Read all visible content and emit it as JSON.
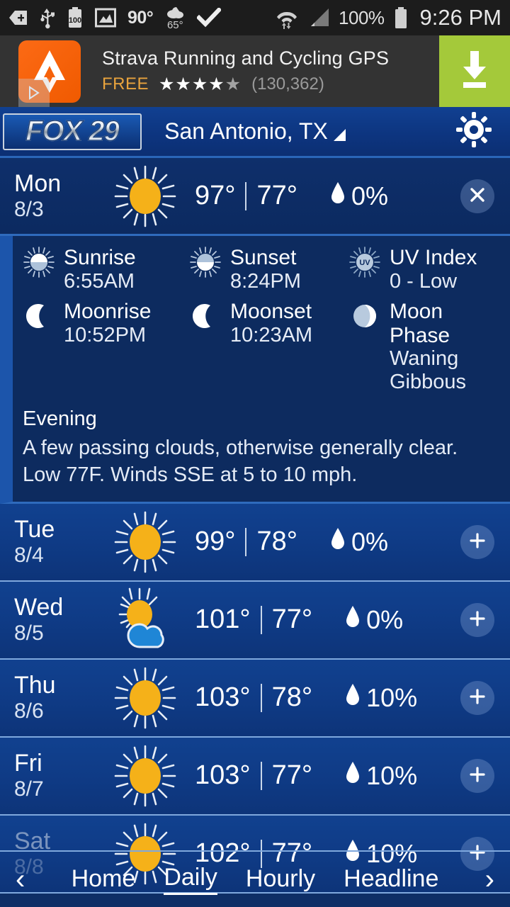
{
  "statusbar": {
    "icons": [
      "add-icon",
      "usb-icon",
      "battery-saver-icon",
      "picture-icon",
      "weather-icon",
      "checkmark-icon",
      "wifi-icon",
      "signal-icon"
    ],
    "screen_temp": "90°",
    "weather_temp": "65°",
    "battery_percent": "100%",
    "battery_label": "100",
    "clock": "9:26 PM"
  },
  "ad": {
    "title": "Strava Running and Cycling GPS",
    "price": "FREE",
    "stars": "★★★★",
    "half_star": "★",
    "rating_count": "(130,362)",
    "cta_icon": "download-icon",
    "adchoices_icon": "adchoices-icon"
  },
  "header": {
    "logo_text": "FOX 29",
    "logo_fox": "FOX",
    "logo_num": "29",
    "city": "San Antonio, TX",
    "dropdown_icon": "triangle-down-icon",
    "settings_icon": "gear-icon"
  },
  "today": {
    "dow": "Mon",
    "date": "8/3",
    "icon": "sunny-icon",
    "high": "97°",
    "low": "77°",
    "precip_icon": "raindrop-icon",
    "precip": "0%",
    "close_icon": "close-icon"
  },
  "detail": {
    "astro": [
      [
        {
          "icon": "sunrise-icon",
          "label": "Sunrise",
          "value": "6:55AM"
        },
        {
          "icon": "sunset-icon",
          "label": "Sunset",
          "value": "8:24PM"
        },
        {
          "icon": "uv-index-icon",
          "label": "UV Index",
          "value": "0 - Low"
        }
      ],
      [
        {
          "icon": "moonrise-icon",
          "label": "Moonrise",
          "value": "10:52PM"
        },
        {
          "icon": "moonset-icon",
          "label": "Moonset",
          "value": "10:23AM"
        },
        {
          "icon": "moon-phase-icon",
          "label": "Moon Phase",
          "value": "Waning Gibbous"
        }
      ]
    ],
    "period_title": "Evening",
    "period_text": "A few passing clouds, otherwise generally clear. Low 77F. Winds SSE at 5 to 10 mph."
  },
  "forecast": [
    {
      "dow": "Tue",
      "date": "8/4",
      "icon": "sunny-icon",
      "high": "99°",
      "low": "78°",
      "precip": "0%",
      "expand_icon": "plus-icon"
    },
    {
      "dow": "Wed",
      "date": "8/5",
      "icon": "partly-cloudy-icon",
      "high": "101°",
      "low": "77°",
      "precip": "0%",
      "expand_icon": "plus-icon"
    },
    {
      "dow": "Thu",
      "date": "8/6",
      "icon": "sunny-icon",
      "high": "103°",
      "low": "78°",
      "precip": "10%",
      "expand_icon": "plus-icon"
    },
    {
      "dow": "Fri",
      "date": "8/7",
      "icon": "sunny-icon",
      "high": "103°",
      "low": "77°",
      "precip": "10%",
      "expand_icon": "plus-icon"
    },
    {
      "dow": "Sat",
      "date": "8/8",
      "icon": "sunny-icon",
      "high": "102°",
      "low": "77°",
      "precip": "10%",
      "expand_icon": "plus-icon"
    }
  ],
  "bottomnav": {
    "prev_icon": "chevron-left-icon",
    "next_icon": "chevron-right-icon",
    "items": [
      {
        "label": "Home",
        "active": false
      },
      {
        "label": "Daily",
        "active": true
      },
      {
        "label": "Hourly",
        "active": false
      },
      {
        "label": "Headline",
        "active": false
      }
    ]
  },
  "colors": {
    "brand_blue": "#11418f",
    "panel_navy": "#0d2b5f",
    "accent_sun": "#f5b119",
    "divider": "#7fa8dd",
    "ad_green": "#a4c93a",
    "ad_orange": "#fc6a15"
  }
}
